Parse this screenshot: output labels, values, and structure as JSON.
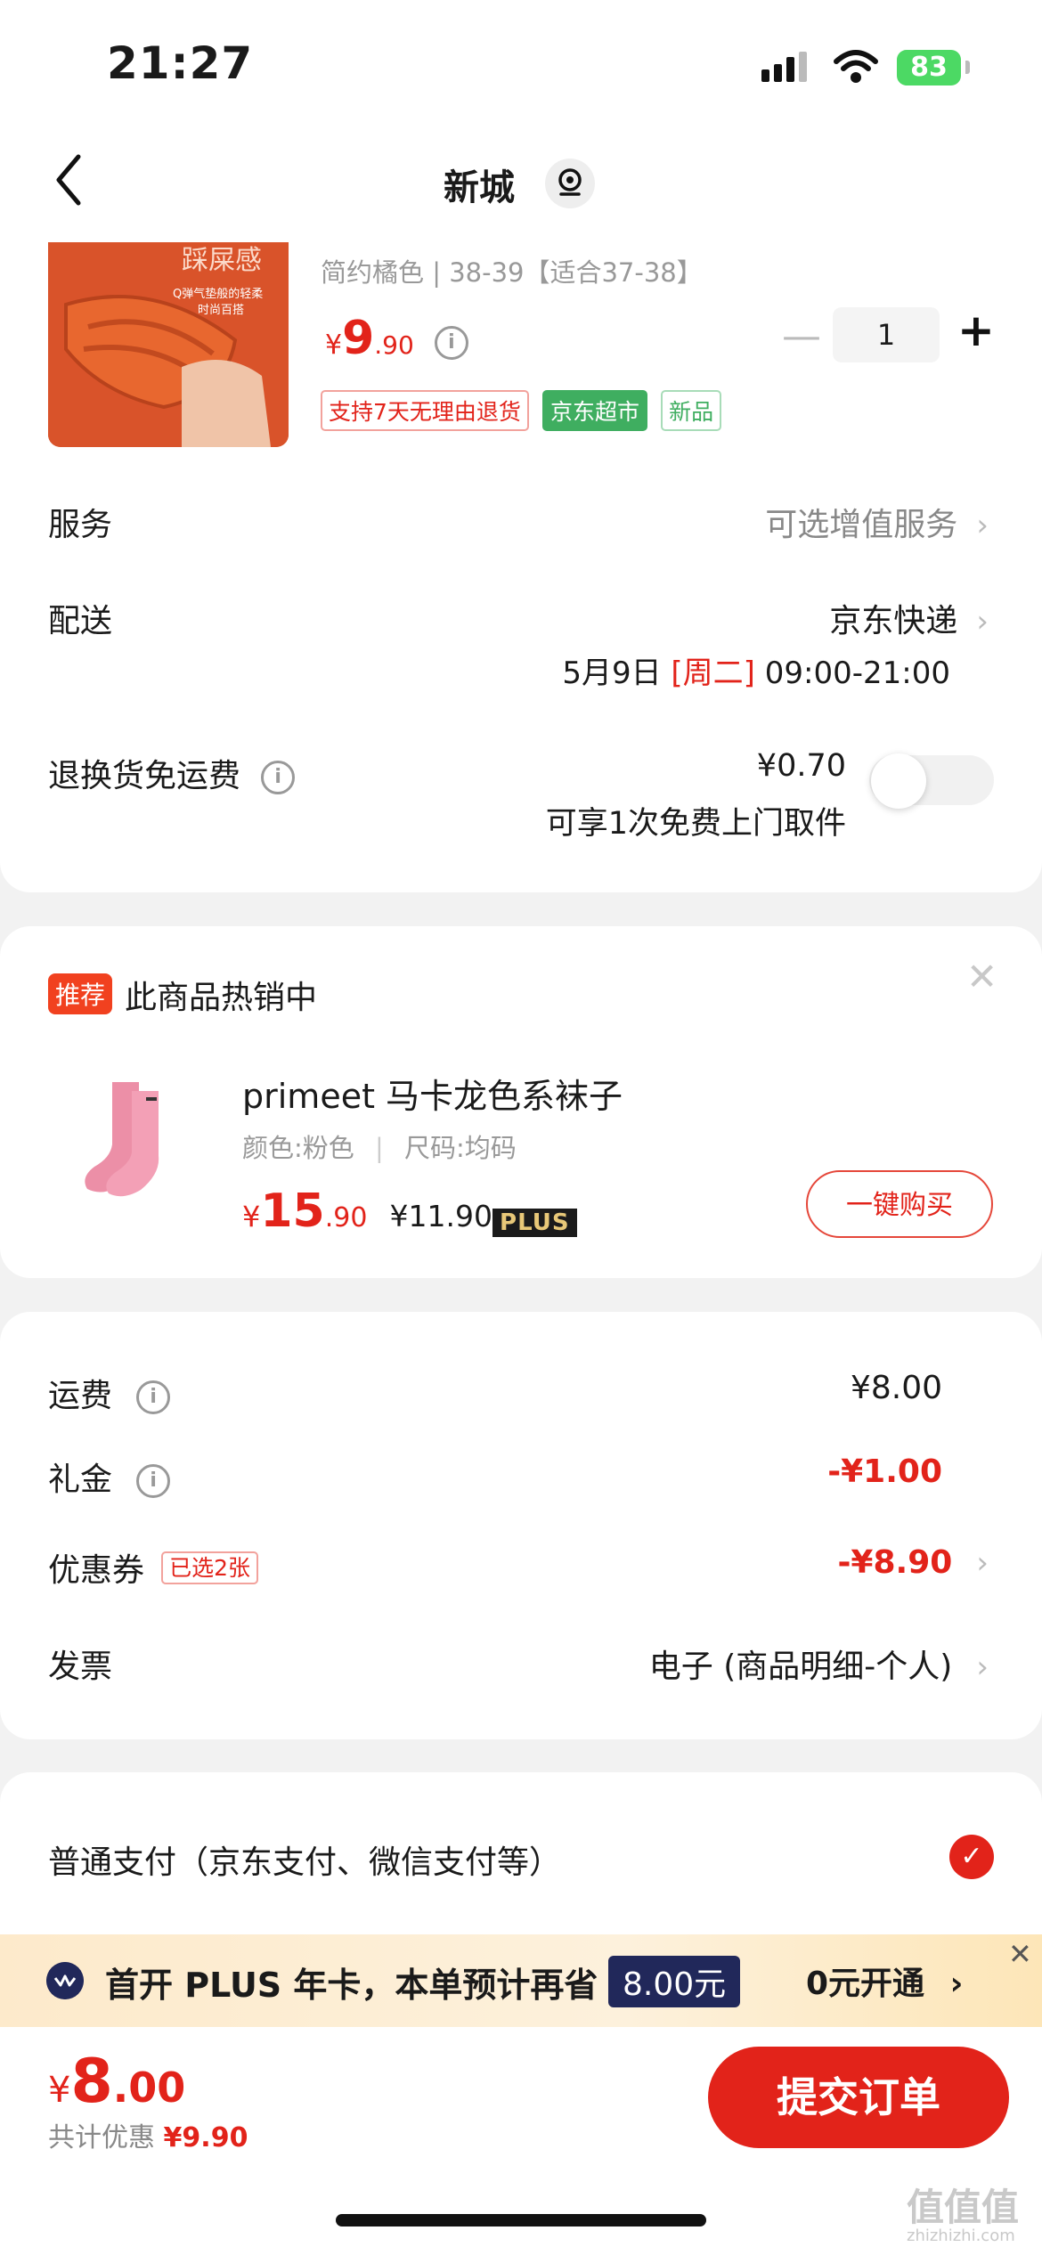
{
  "status_bar": {
    "time": "21:27",
    "battery": "83"
  },
  "nav": {
    "title": "新城"
  },
  "product": {
    "variant": "简约橘色 | 38-39【适合37-38】",
    "price_symbol": "¥",
    "price_int": "9",
    "price_dec": ".90",
    "quantity": "1",
    "tags": [
      "支持7天无理由退货",
      "京东超市",
      "新品"
    ]
  },
  "service": {
    "label": "服务",
    "value": "可选增值服务"
  },
  "delivery": {
    "label": "配送",
    "value": "京东快递",
    "date": "5月9日",
    "weekday": "[周二]",
    "time": "09:00-21:00"
  },
  "return_shipping": {
    "label": "退换货免运费",
    "price": "¥0.70",
    "note": "可享1次免费上门取件"
  },
  "recommend": {
    "badge": "推荐",
    "title": "此商品热销中",
    "product_name": "primeet 马卡龙色系袜子",
    "color": "颜色:粉色",
    "size": "尺码:均码",
    "price_symbol": "¥",
    "price_int": "15",
    "price_dec": ".90",
    "plus_price": "¥11.90",
    "plus_label": "PLUS",
    "buy_button": "一键购买"
  },
  "fees": {
    "shipping_label": "运费",
    "shipping_value": "¥8.00",
    "gift_label": "礼金",
    "gift_value": "-¥1.00",
    "coupon_label": "优惠券",
    "coupon_tag": "已选2张",
    "coupon_value": "-¥8.90",
    "invoice_label": "发票",
    "invoice_value": "电子 (商品明细-个人)"
  },
  "payment": {
    "label": "普通支付（京东支付、微信支付等）"
  },
  "plus_banner": {
    "text": "首开 PLUS 年卡，本单预计再省",
    "amount": "8.00元",
    "action": "0元开通"
  },
  "bottom": {
    "total_symbol": "¥",
    "total_int": "8",
    "total_dec": ".00",
    "discount_label": "共计优惠",
    "discount_value": "¥9.90",
    "submit": "提交订单"
  },
  "watermark": {
    "main": "值值值",
    "sub": "zhizhizhi.com"
  }
}
